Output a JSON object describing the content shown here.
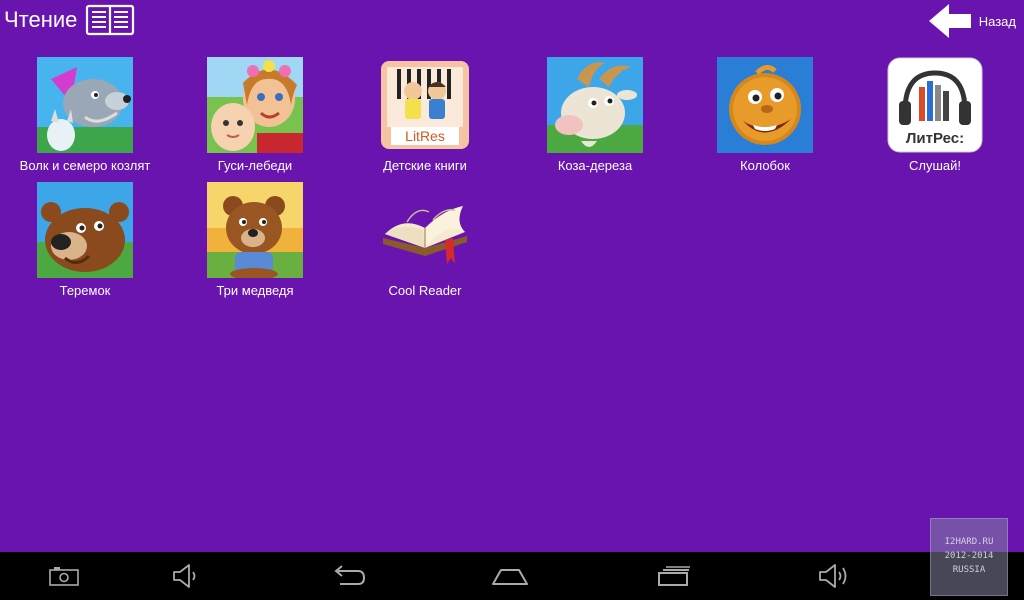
{
  "header": {
    "title": "Чтение",
    "title_icon": "open-book-icon",
    "back_label": "Назад",
    "back_icon": "back-arrow-icon"
  },
  "apps": [
    {
      "label": "Волк и семеро козлят",
      "icon": "wolf-goats-icon"
    },
    {
      "label": "Гуси-лебеди",
      "icon": "geese-swans-icon"
    },
    {
      "label": "Детские книги",
      "icon": "litres-kids-icon",
      "badge": "LitRes"
    },
    {
      "label": "Коза-дереза",
      "icon": "goat-icon"
    },
    {
      "label": "Колобок",
      "icon": "kolobok-icon"
    },
    {
      "label": "Слушай!",
      "icon": "litres-listen-icon",
      "badge": "ЛитРес:"
    },
    {
      "label": "Теремок",
      "icon": "bear-teremok-icon"
    },
    {
      "label": "Три медведя",
      "icon": "three-bears-icon"
    },
    {
      "label": "Cool Reader",
      "icon": "cool-reader-book-icon"
    }
  ],
  "navbar": {
    "items": [
      "screenshot-icon",
      "volume-down-icon",
      "back-icon",
      "home-icon",
      "recent-apps-icon",
      "volume-up-icon"
    ]
  },
  "watermark": {
    "line1": "I2HARD.RU",
    "line2": "2012-2014",
    "line3": "RUSSIA"
  },
  "colors": {
    "background": "#6a14b0",
    "navbar": "#000000",
    "text": "#ffffff"
  }
}
